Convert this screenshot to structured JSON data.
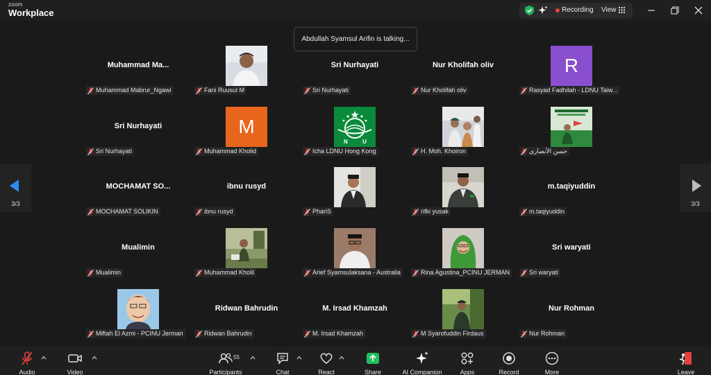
{
  "app": {
    "brand_small": "zoom",
    "brand_big": "Workplace"
  },
  "titlebar": {
    "recording_label": "Recording",
    "view_label": "View"
  },
  "talking_indicator": "Abdullah Syamsul Arifin is talking...",
  "pager": {
    "left": "3/3",
    "right": "3/3"
  },
  "participants": [
    {
      "name": "Muhammad  Ma...",
      "label": "Muhammad Mabrur_Ngawi"
    },
    {
      "name": "",
      "label": "Fani Ruusul M",
      "avatar": "photo-young-man"
    },
    {
      "name": "Sri Nurhayati",
      "label": "Sri Nurhayati"
    },
    {
      "name": "Nur Kholifah oliv",
      "label": "Nur Kholifah oliv"
    },
    {
      "name": "",
      "label": "Rasyad Fadhilah - LDNU Taiw...",
      "letter": "R",
      "letter_color": "#8a4fcf"
    },
    {
      "name": "Sri Nurhayati",
      "label": "Sri Nurhayati"
    },
    {
      "name": "",
      "label": "Muhammad Kholid",
      "letter": "M",
      "letter_color": "#e8651c"
    },
    {
      "name": "",
      "label": "Icha LDNU Hong Kong",
      "avatar": "nu-logo"
    },
    {
      "name": "",
      "label": "H. Moh. Khoiron",
      "avatar": "photo-group"
    },
    {
      "name": "",
      "label": "حسن الأنصارى",
      "avatar": "photo-green-poster"
    },
    {
      "name": "MOCHAMAT  SO...",
      "label": "MOCHAMAT SOLIKIN"
    },
    {
      "name": "ibnu rusyd",
      "label": "ibnu rusyd"
    },
    {
      "name": "",
      "label": "PhariS",
      "avatar": "photo-man-peci"
    },
    {
      "name": "",
      "label": "rifki yusak",
      "avatar": "photo-man-jacket"
    },
    {
      "name": "m.taqiyuddin",
      "label": "m.taqiyuddin"
    },
    {
      "name": "Mualimin",
      "label": "Mualimin"
    },
    {
      "name": "",
      "label": "Muhammad Kholil",
      "avatar": "photo-room"
    },
    {
      "name": "",
      "label": "Arief Syamsulaksana - Australia",
      "avatar": "photo-man-glasses"
    },
    {
      "name": "",
      "label": "Rina Agustina_PCINU JERMAN",
      "avatar": "photo-hijab"
    },
    {
      "name": "Sri waryati",
      "label": "Sri waryati"
    },
    {
      "name": "",
      "label": "Miftah El Azmi - PCINU Jerman",
      "avatar": "photo-caricature"
    },
    {
      "name": "Ridwan Bahrudin",
      "label": "Ridwan Bahrudin"
    },
    {
      "name": "M. Irsad Khamzah",
      "label": "M. Irsad Khamzah"
    },
    {
      "name": "",
      "label": "M Syarofuddin Firdaus",
      "avatar": "photo-outdoor"
    },
    {
      "name": "Nur Rohman",
      "label": "Nur Rohman"
    }
  ],
  "toolbar": {
    "audio": "Audio",
    "video": "Video",
    "participants": "Participants",
    "participants_count": "55",
    "chat": "Chat",
    "react": "React",
    "share": "Share",
    "ai_companion": "AI Companion",
    "apps": "Apps",
    "record": "Record",
    "more": "More",
    "leave": "Leave"
  },
  "colors": {
    "share_green": "#1fbf5e",
    "recording_red": "#e5433f",
    "pager_arrow_blue": "#2b8cf0",
    "muted_red": "#e0413e"
  }
}
